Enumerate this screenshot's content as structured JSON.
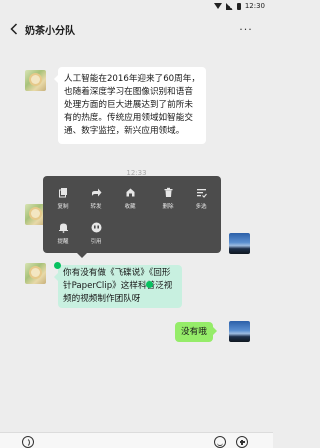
{
  "status_bar": {
    "time": "12:30",
    "icons": [
      "wifi-icon",
      "signal-icon",
      "battery-icon"
    ]
  },
  "nav": {
    "title": "奶茶小分队",
    "back_icon": "chevron-left-icon",
    "more_label": "···"
  },
  "messages": [
    {
      "side": "left",
      "avatar": "flower-avatar",
      "text": "人工智能在2016年迎来了60周年，也随着深度学习在图像识别和语音处理方面的巨大进展达到了前所未有的热度。传统应用领域如智能交通、数字监控，新兴应用领域。"
    },
    {
      "side": "left",
      "avatar": "flower-avatar",
      "text": "你有没有做《飞碟说》《回形针PaperClip》这样科普泛视频的视频制作团队呀",
      "selected": true
    },
    {
      "side": "right",
      "avatar": "sky-avatar",
      "text": "没有哦"
    }
  ],
  "timestamp": "12:33",
  "context_menu": {
    "items": [
      {
        "label": "复制",
        "icon": "copy-icon"
      },
      {
        "label": "转发",
        "icon": "forward-icon"
      },
      {
        "label": "收藏",
        "icon": "favorite-icon"
      },
      {
        "label": "删除",
        "icon": "delete-icon"
      },
      {
        "label": "多选",
        "icon": "multiselect-icon"
      },
      {
        "label": "提醒",
        "icon": "remind-icon"
      },
      {
        "label": "引用",
        "icon": "quote-icon"
      }
    ]
  },
  "bottom_bar": {
    "icons": [
      "voice-icon",
      "emoji-icon",
      "plus-icon"
    ]
  },
  "colors": {
    "background": "#ededed",
    "bubble_left": "#ffffff",
    "bubble_right": "#95ec69",
    "selection": "#c8f0e0",
    "selection_handle": "#07c160",
    "menu_bg": "#4c4c4c"
  }
}
